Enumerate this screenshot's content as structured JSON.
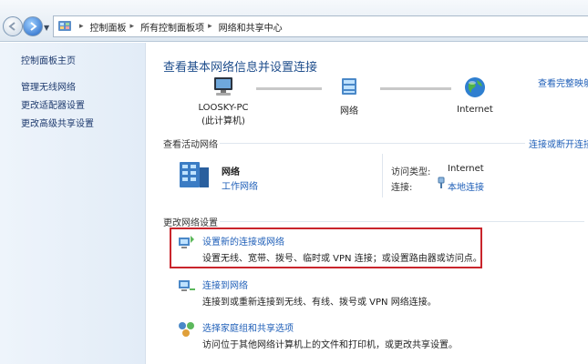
{
  "address_bar": {
    "breadcrumbs": [
      "控制面板",
      "所有控制面板项",
      "网络和共享中心"
    ]
  },
  "left_pane": {
    "home": "控制面板主页",
    "links": [
      "管理无线网络",
      "更改适配器设置",
      "更改高级共享设置"
    ]
  },
  "main": {
    "title": "查看基本网络信息并设置连接",
    "view_full_map": "查看完整映射",
    "map": {
      "computer_name": "LOOSKY-PC",
      "computer_sub": "(此计算机)",
      "network_label": "网络",
      "internet_label": "Internet"
    },
    "active": {
      "heading": "查看活动网络",
      "connect_disconnect": "连接或断开连接",
      "network_name": "网络",
      "network_type": "工作网络",
      "access_type_label": "访问类型:",
      "access_type_value": "Internet",
      "connections_label": "连接:",
      "connections_value": "本地连接"
    },
    "change": {
      "heading": "更改网络设置",
      "tasks": [
        {
          "title": "设置新的连接或网络",
          "desc": "设置无线、宽带、拨号、临时或 VPN 连接；或设置路由器或访问点。"
        },
        {
          "title": "连接到网络",
          "desc": "连接到或重新连接到无线、有线、拨号或 VPN 网络连接。"
        },
        {
          "title": "选择家庭组和共享选项",
          "desc": "访问位于其他网络计算机上的文件和打印机，或更改共享设置。"
        }
      ]
    }
  },
  "colors": {
    "link": "#1f5fb8",
    "title": "#1f4e8c",
    "highlight": "#c9252c"
  }
}
